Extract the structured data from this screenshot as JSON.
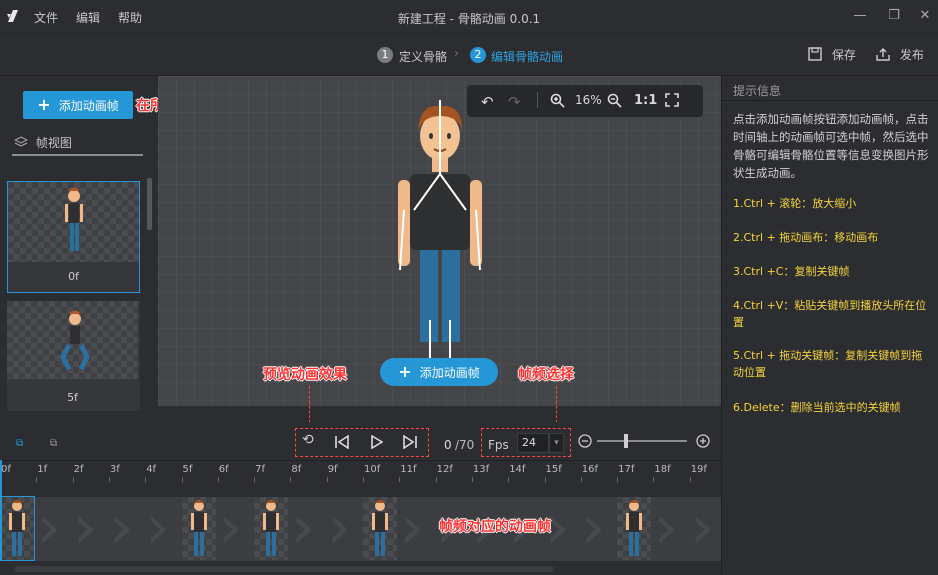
{
  "titlebar": {
    "menu": [
      "文件",
      "编辑",
      "帮助"
    ],
    "title": "新建工程 - 骨骼动画 0.0.1"
  },
  "steps": [
    {
      "num": "1",
      "label": "定义骨骼",
      "active": false
    },
    {
      "num": "2",
      "label": "编辑骨骼动画",
      "active": true
    }
  ],
  "actions": {
    "save": "保存",
    "publish": "发布"
  },
  "left": {
    "add_frame_label": "添加动画帧",
    "tab_label": "帧视图",
    "thumbs": [
      {
        "label": "0f",
        "selected": true
      },
      {
        "label": "5f",
        "selected": false
      }
    ]
  },
  "zoom": {
    "percent": "16%",
    "one_to_one": "1:1"
  },
  "canvas": {
    "add_frame_label": "添加动画帧"
  },
  "annotations": {
    "add_here": "在所需地方添加动画帧",
    "preview": "预览动画效果",
    "fps_select": "帧频选择",
    "frame_keys": "帧频对应的动画帧"
  },
  "hints": {
    "title": "提示信息",
    "desc": "点击添加动画帧按钮添加动画帧，点击时间轴上的动画帧可选中帧，然后选中骨骼可编辑骨骼位置等信息变换图片形状生成动画。",
    "items": [
      "1.Ctrl + 滚轮：放大缩小",
      "2.Ctrl + 拖动画布：移动画布",
      "3.Ctrl +C：复制关键帧",
      "4.Ctrl +V：粘贴关键帧到播放头所在位置",
      "5.Ctrl + 拖动关键帧：复制关键帧到拖动位置",
      "6.Delete：删除当前选中的关键帧"
    ]
  },
  "playback": {
    "current": "0",
    "total": "/70",
    "fps_label": "Fps",
    "fps_value": "24"
  },
  "timeline": {
    "ticks": [
      "0f",
      "1f",
      "2f",
      "3f",
      "4f",
      "5f",
      "6f",
      "7f",
      "8f",
      "9f",
      "10f",
      "11f",
      "12f",
      "13f",
      "14f",
      "15f",
      "16f",
      "17f",
      "18f",
      "19f"
    ],
    "keyframes": [
      "0f",
      "5f",
      "7f",
      "10f",
      "17f"
    ]
  },
  "colors": {
    "accent": "#2597d6",
    "annotation": "#ff3333",
    "hint_item": "#f5d33a"
  }
}
